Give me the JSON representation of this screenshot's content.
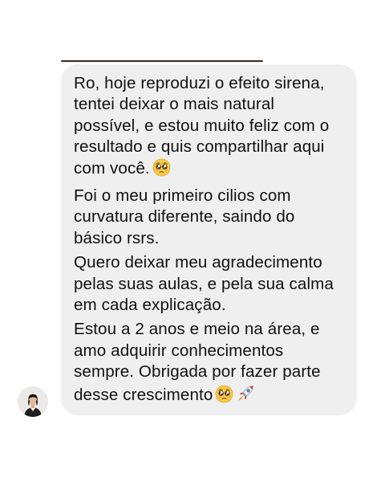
{
  "conversation": {
    "message": {
      "paragraphs": [
        {
          "lines": [
            "Ro, hoje reproduzi o efeito sirena,",
            "tentei deixar o mais natural",
            "possível, e estou muito feliz com o",
            "resultado e quis compartilhar aqui",
            "com você."
          ],
          "trailing_emoji": [
            "pleading-face-emoji"
          ]
        },
        {
          "lines": [
            "Foi o meu primeiro cilios com",
            "curvatura diferente, saindo do",
            "básico rsrs."
          ],
          "trailing_emoji": []
        },
        {
          "lines": [
            "Quero deixar meu agradecimento",
            "pelas suas aulas, e pela sua calma",
            "em cada explicação."
          ],
          "trailing_emoji": []
        },
        {
          "lines": [
            "Estou a 2 anos e meio na área, e",
            "amo adquirir conhecimentos",
            "sempre. Obrigada por fazer parte",
            "desse crescimento"
          ],
          "trailing_emoji": [
            "pleading-face-emoji",
            "rocket-emoji"
          ]
        }
      ],
      "bubble_color": "#efefef",
      "text_color": "#111111"
    },
    "reply_indicator_color": "#3f2a1e",
    "sender_avatar_icon": "avatar-person-icon"
  }
}
